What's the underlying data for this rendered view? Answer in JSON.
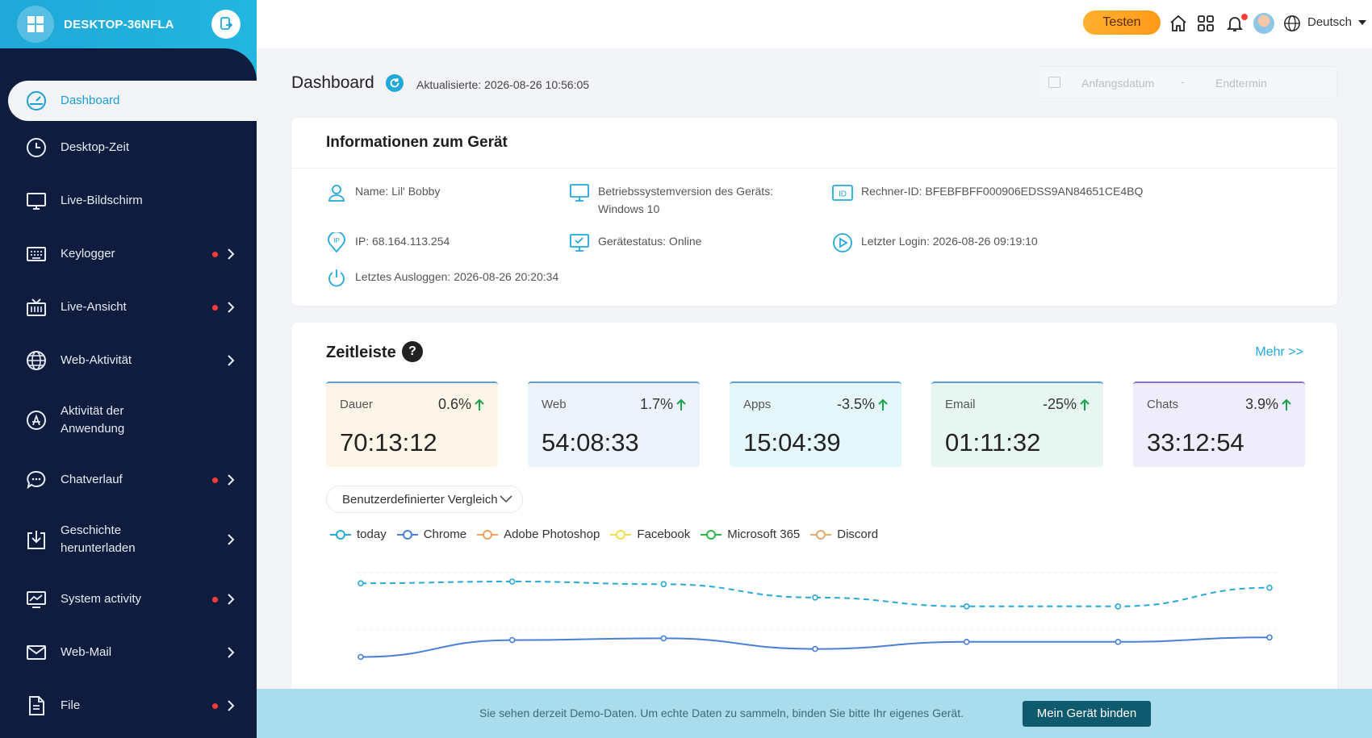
{
  "brand": {
    "device_name": "DESKTOP-36NFLA"
  },
  "sidebar": {
    "items": [
      {
        "label": "Dashboard",
        "icon": "gauge-icon",
        "dot": false,
        "chevron": false
      },
      {
        "label": "Desktop-Zeit",
        "icon": "clock-icon",
        "dot": false,
        "chevron": false
      },
      {
        "label": "Live-Bildschirm",
        "icon": "monitor-icon",
        "dot": false,
        "chevron": false
      },
      {
        "label": "Keylogger",
        "icon": "keyboard-icon",
        "dot": true,
        "chevron": true
      },
      {
        "label": "Live-Ansicht",
        "icon": "tv-icon",
        "dot": true,
        "chevron": true
      },
      {
        "label": "Web-Aktivität",
        "icon": "globe-icon",
        "dot": false,
        "chevron": true
      },
      {
        "label": "Aktivität der Anwendung",
        "icon": "app-store-icon",
        "dot": false,
        "chevron": false
      },
      {
        "label": "Chatverlauf",
        "icon": "chat-icon",
        "dot": true,
        "chevron": true
      },
      {
        "label": "Geschichte herunterladen",
        "icon": "download-icon",
        "dot": false,
        "chevron": true
      },
      {
        "label": "System activity",
        "icon": "system-chart-icon",
        "dot": true,
        "chevron": true
      },
      {
        "label": "Web-Mail",
        "icon": "mail-icon",
        "dot": false,
        "chevron": true
      },
      {
        "label": "File",
        "icon": "file-icon",
        "dot": true,
        "chevron": true
      }
    ]
  },
  "topbar": {
    "trial_label": "Testen",
    "language": "Deutsch"
  },
  "dashboard": {
    "title": "Dashboard",
    "updated": "Aktualisierte: 2026-08-26 10:56:05",
    "date_start_placeholder": "Anfangsdatum",
    "date_separator": "-",
    "date_end_placeholder": "Endtermin"
  },
  "device_info": {
    "title": "Informationen zum Gerät",
    "name": "Name: Lil' Bobby",
    "os_line1": "Betriebssystemversion des Geräts:",
    "os_line2": "Windows 10",
    "computer_id": "Rechner-ID: BFEBFBFF000906EDSS9AN84651CE4BQ",
    "ip": "IP: 68.164.113.254",
    "status": "Gerätestatus: Online",
    "last_login": "Letzter Login: 2026-08-26 09:19:10",
    "last_logout": "Letztes Ausloggen: 2026-08-26 20:20:34"
  },
  "timeline": {
    "title": "Zeitleiste",
    "help": "?",
    "more": "Mehr >>",
    "stats": [
      {
        "label": "Dauer",
        "pct": "0.6%",
        "value": "70:13:12",
        "bg": "#fdf6e8",
        "border": "#5aa0d8"
      },
      {
        "label": "Web",
        "pct": "1.7%",
        "value": "54:08:33",
        "bg": "#edf3fc",
        "border": "#5aa0d8"
      },
      {
        "label": "Apps",
        "pct": "-3.5%",
        "value": "15:04:39",
        "bg": "#e6f7fb",
        "border": "#5aa0d8"
      },
      {
        "label": "Email",
        "pct": "-25%",
        "value": "01:11:32",
        "bg": "#e7f6f1",
        "border": "#5aa0d8"
      },
      {
        "label": "Chats",
        "pct": "3.9%",
        "value": "33:12:54",
        "bg": "#efedfb",
        "border": "#8b6fd6"
      }
    ],
    "compare_label": "Benutzerdefinierter Vergleich",
    "legend": [
      {
        "name": "today",
        "color": "#27a9d6"
      },
      {
        "name": "Chrome",
        "color": "#4a7fd8"
      },
      {
        "name": "Adobe Photoshop",
        "color": "#f0a060"
      },
      {
        "name": "Facebook",
        "color": "#f2dc4a"
      },
      {
        "name": "Microsoft 365",
        "color": "#2fb84a"
      },
      {
        "name": "Discord",
        "color": "#e3a86a"
      }
    ]
  },
  "chart_data": {
    "type": "line",
    "x": [
      1,
      2,
      3,
      4,
      5,
      6,
      7
    ],
    "series": [
      {
        "name": "today",
        "color": "#27a9d6",
        "dashed": true,
        "values": [
          0.88,
          0.9,
          0.87,
          0.72,
          0.62,
          0.62,
          0.83
        ]
      },
      {
        "name": "Chrome",
        "color": "#4a7fd8",
        "dashed": false,
        "values": [
          0.05,
          0.24,
          0.26,
          0.14,
          0.22,
          0.22,
          0.27
        ]
      }
    ],
    "ylim": [
      0,
      1
    ],
    "grid": true
  },
  "banner": {
    "text": "Sie sehen derzeit Demo-Daten. Um echte Daten zu sammeln, binden Sie bitte Ihr eigenes Gerät.",
    "button": "Mein Gerät binden"
  }
}
